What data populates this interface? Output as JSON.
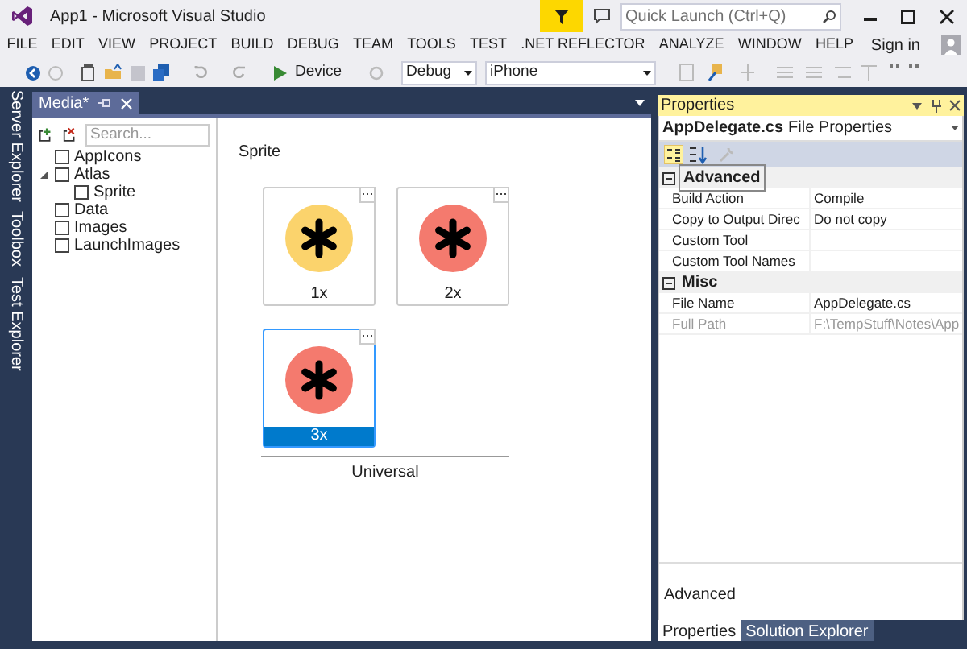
{
  "window": {
    "title": "App1 - Microsoft Visual Studio",
    "quick_launch": {
      "placeholder": "Quick Launch (Ctrl+Q)"
    }
  },
  "menu": [
    "FILE",
    "EDIT",
    "VIEW",
    "PROJECT",
    "BUILD",
    "DEBUG",
    "TEAM",
    "TOOLS",
    "TEST",
    ".NET REFLECTOR",
    "ANALYZE",
    "WINDOW",
    "HELP"
  ],
  "sign_in": "Sign in",
  "toolbar": {
    "run_target": "Device",
    "configuration": "Debug",
    "platform": "iPhone"
  },
  "side_tabs": [
    "Server Explorer",
    "Toolbox",
    "Test Explorer"
  ],
  "document_tab": {
    "title": "Media*"
  },
  "tree": {
    "search": {
      "placeholder": "Search..."
    },
    "items": [
      {
        "label": "AppIcons",
        "checked": false,
        "expanded": false
      },
      {
        "label": "Atlas",
        "checked": false,
        "expanded": true,
        "children": [
          {
            "label": "Sprite",
            "checked": false,
            "expanded": false
          }
        ]
      },
      {
        "label": "Data",
        "checked": false,
        "expanded": false
      },
      {
        "label": "Images",
        "checked": false,
        "expanded": false
      },
      {
        "label": "LaunchImages",
        "checked": false,
        "expanded": false
      }
    ]
  },
  "editor": {
    "title": "Sprite",
    "group": "Universal",
    "images": [
      {
        "label": "1x",
        "color": "#fbd36c",
        "selected": false
      },
      {
        "label": "2x",
        "color": "#f47a6e",
        "selected": false
      },
      {
        "label": "3x",
        "color": "#f47a6e",
        "selected": true
      }
    ]
  },
  "properties": {
    "title": "Properties",
    "object": "AppDelegate.cs",
    "object_type": "File Properties",
    "categories": [
      {
        "name": "Advanced",
        "rows": [
          {
            "name": "Build Action",
            "value": "Compile",
            "disabled": false
          },
          {
            "name": "Copy to Output Direc",
            "value": "Do not copy",
            "disabled": false
          },
          {
            "name": "Custom Tool",
            "disabled": false
          },
          {
            "name": "Custom Tool Names",
            "disabled": false
          }
        ]
      },
      {
        "name": "Misc",
        "rows": [
          {
            "name": "File Name",
            "value": "AppDelegate.cs",
            "disabled": false
          },
          {
            "name": "Full Path",
            "value": "F:\\TempStuff\\Notes\\App",
            "disabled": true
          }
        ]
      }
    ],
    "description": "Advanced"
  },
  "bottom_tabs": [
    {
      "label": "Properties",
      "selected": true
    },
    {
      "label": "Solution Explorer",
      "selected": false
    }
  ]
}
